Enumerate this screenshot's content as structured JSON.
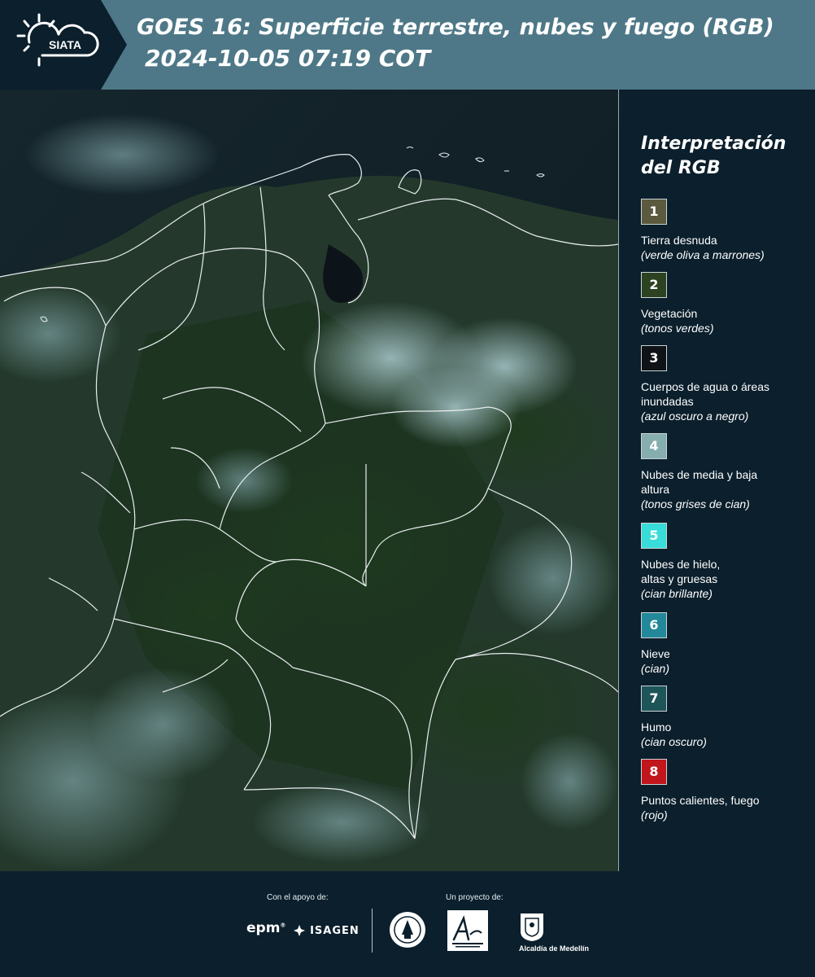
{
  "header": {
    "logo_text": "SIATA",
    "title_line1": "GOES 16: Superficie terrestre, nubes y fuego (RGB)",
    "title_line2": "2024-10-05 07:19 COT"
  },
  "legend": {
    "title": "Interpretación del RGB",
    "items": [
      {
        "number": "1",
        "label": "Tierra desnuda",
        "desc": "(verde oliva a marrones)",
        "color": "#5b5a3e"
      },
      {
        "number": "2",
        "label": "Vegetación",
        "desc": "(tonos verdes)",
        "color": "#2c4221"
      },
      {
        "number": "3",
        "label": "Cuerpos de agua o áreas inundadas",
        "desc": "(azul oscuro a negro)",
        "color": "#0f1216"
      },
      {
        "number": "4",
        "label": "Nubes de media y baja altura",
        "desc": "(tonos grises de cian)",
        "color": "#86aeae"
      },
      {
        "number": "5",
        "label": "Nubes de hielo, altas y gruesas",
        "desc": "(cian brillante)",
        "color": "#38dcd8"
      },
      {
        "number": "6",
        "label": "Nieve",
        "desc": "(cian)",
        "color": "#23889a"
      },
      {
        "number": "7",
        "label": "Humo",
        "desc": "(cian oscuro)",
        "color": "#1e5559"
      },
      {
        "number": "8",
        "label": "Puntos calientes, fuego",
        "desc": "(rojo)",
        "color": "#c1161c"
      }
    ]
  },
  "footer": {
    "support_label": "Con el apoyo de:",
    "project_label": "Un proyecto de:",
    "epm_logo": "epm",
    "isagen_logo": "ISAGEN",
    "alcaldia_label": "Alcaldía de Medellín"
  }
}
